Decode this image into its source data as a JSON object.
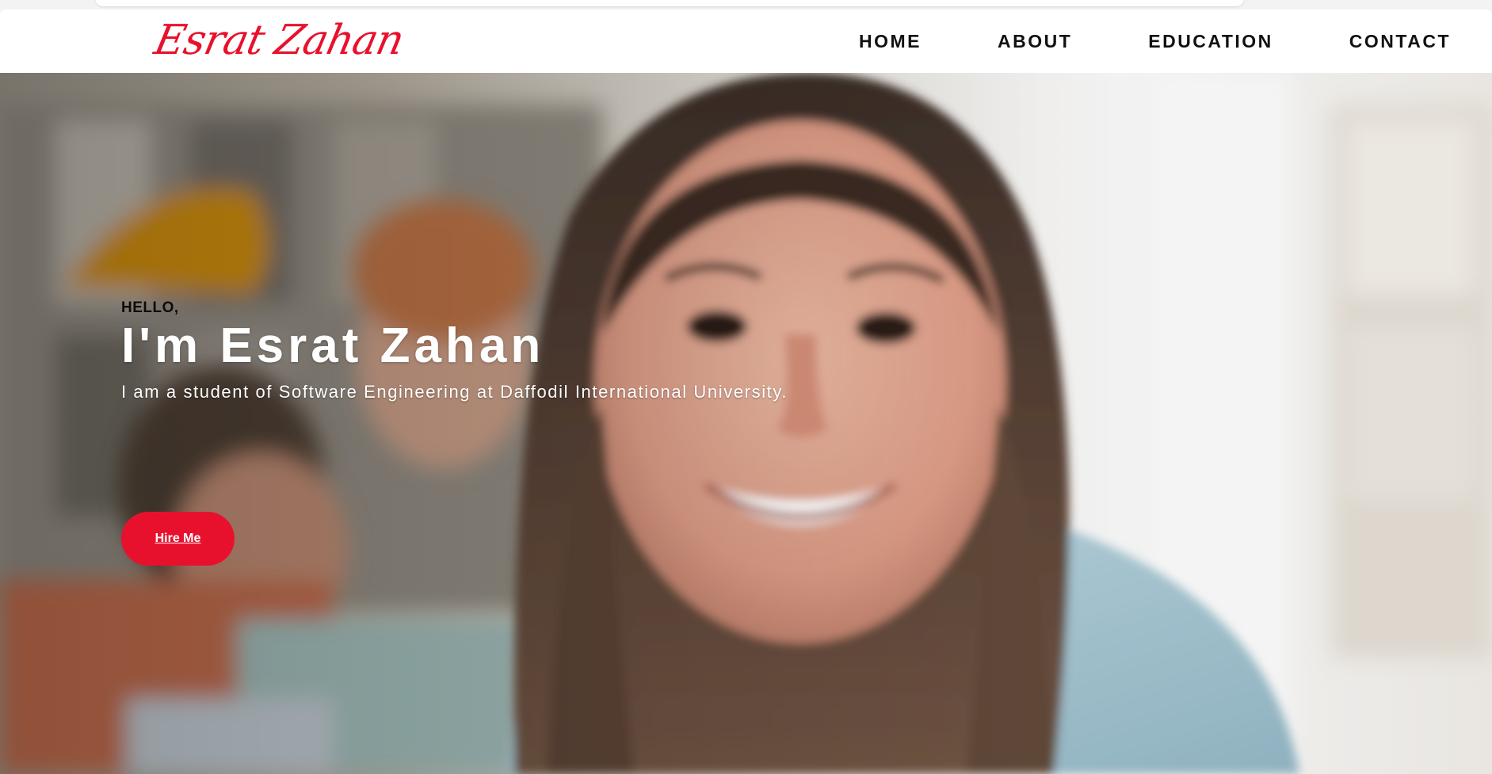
{
  "brand": {
    "logo_text": "Esrat Zahan",
    "accent_color": "#e8112d"
  },
  "nav": {
    "items": [
      {
        "label": "HOME"
      },
      {
        "label": "ABOUT"
      },
      {
        "label": "EDUCATION"
      },
      {
        "label": "CONTACT"
      }
    ]
  },
  "hero": {
    "greeting": "HELLO,",
    "title": "I'm Esrat Zahan",
    "subtitle": "I am a student of Software Engineering at Daffodil International University.",
    "cta_label": "Hire Me",
    "background_image": "smiling-student-photo"
  }
}
